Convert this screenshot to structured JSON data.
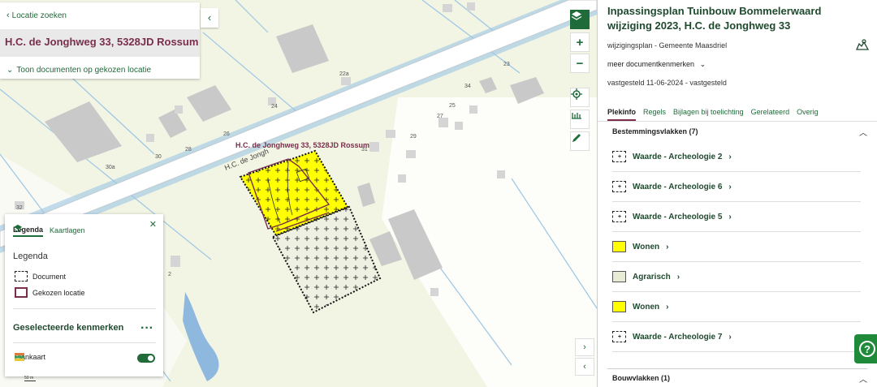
{
  "search_panel": {
    "back_label": "Locatie zoeken",
    "address": "H.C. de Jonghweg 33, 5328JD Rossum",
    "docs_label": "Toon documenten op gekozen locatie"
  },
  "map": {
    "parcel_label": "H.C. de Jonghweg 33, 5328JD Rossum",
    "street_label": "H.C. de Jongh",
    "house_numbers": [
      "22a",
      "24",
      "26",
      "28",
      "30",
      "30a",
      "32",
      "34",
      "23",
      "25",
      "27",
      "29",
      "31",
      "2"
    ]
  },
  "legend": {
    "tab_active": "Legenda",
    "tab_other": "Kaartlagen",
    "heading": "Legenda",
    "item_document": "Document",
    "item_location": "Gekozen locatie",
    "selected_title": "Geselecteerde kenmerken",
    "plankaart": "Plankaart",
    "scale": "50 m"
  },
  "panel": {
    "title": "Inpassingsplan Tuinbouw Bommelerwaard wijziging 2023, H.C. de Jonghweg 33",
    "subtitle": "wijzigingsplan - Gemeente Maasdriel",
    "meta_label": "meer documentkenmerken",
    "date": "vastgesteld 11-06-2024 - vastgesteld",
    "tabs": [
      "Plekinfo",
      "Regels",
      "Bijlagen bij toelichting",
      "Gerelateerd",
      "Overig"
    ],
    "section_title": "Bestemmingsvlakken (7)",
    "items": [
      {
        "label": "Waarde - Archeologie 2",
        "swatch": "arch"
      },
      {
        "label": "Waarde - Archeologie 6",
        "swatch": "arch"
      },
      {
        "label": "Waarde - Archeologie 5",
        "swatch": "arch"
      },
      {
        "label": "Wonen",
        "swatch": "wonen"
      },
      {
        "label": "Agrarisch",
        "swatch": "agr"
      },
      {
        "label": "Wonen",
        "swatch": "wonen"
      },
      {
        "label": "Waarde - Archeologie 7",
        "swatch": "arch"
      }
    ],
    "bouw_title": "Bouwvlakken (1)"
  },
  "colors": {
    "accent": "#1f6b3a",
    "location": "#7a2e4c",
    "wonen": "#ffff00",
    "agrarisch": "#e8ecd5"
  }
}
